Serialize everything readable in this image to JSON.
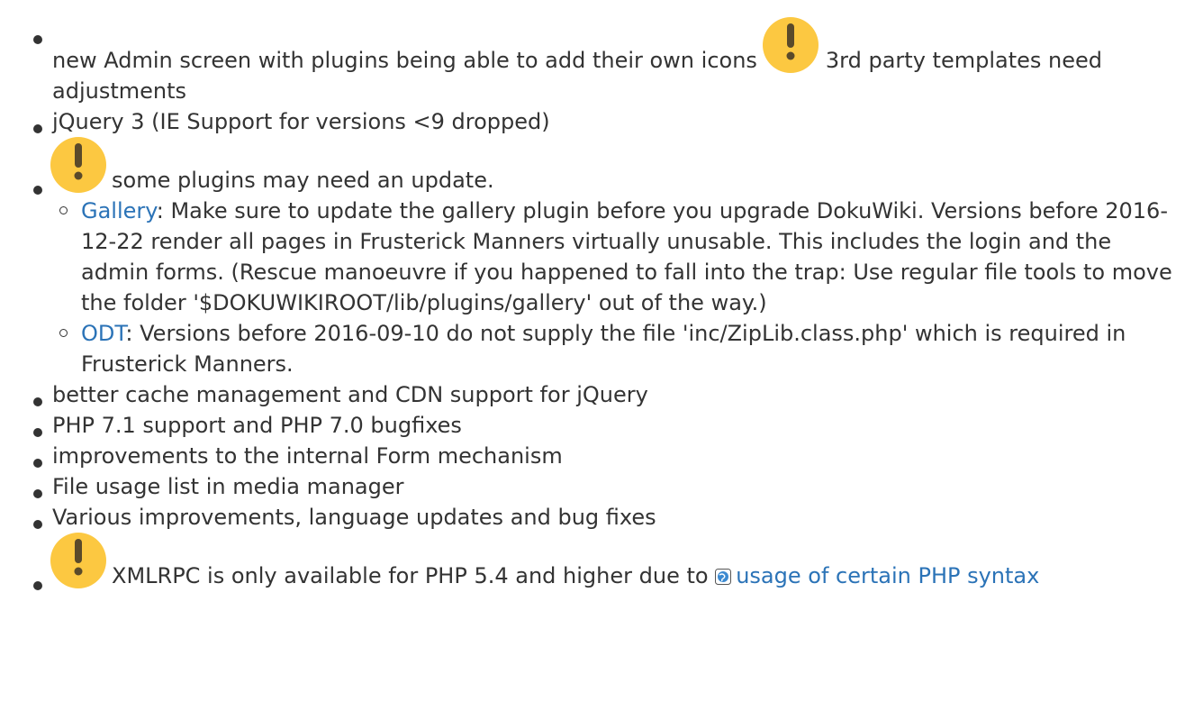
{
  "items": [
    {
      "before_icon": "new Admin screen with plugins being able to add their own icons",
      "after_icon": "3rd party templates need adjustments",
      "icon": "warning-icon"
    },
    {
      "text": "jQuery 3 (IE Support for versions <9 dropped)"
    },
    {
      "text": "some plugins may need an update.",
      "icon": "warning-icon",
      "subitems": [
        {
          "link": "Gallery",
          "text": ": Make sure to update the gallery plugin before you upgrade DokuWiki. Versions before 2016-12-22 render all pages in Frusterick Manners virtually unusable. This includes the login and the admin forms. (Rescue manoeuvre if you happened to fall into the trap: Use regular file tools to move the folder '$DOKUWIKIROOT/lib/plugins/gallery' out of the way.)"
        },
        {
          "link": "ODT",
          "text": ": Versions before 2016-09-10 do not supply the file 'inc/ZipLib.class.php' which is required in Frusterick Manners."
        }
      ]
    },
    {
      "text": "better cache management and CDN support for jQuery"
    },
    {
      "text": "PHP 7.1 support and PHP 7.0 bugfixes"
    },
    {
      "text": "improvements to the internal Form mechanism"
    },
    {
      "text": "File usage list in media manager"
    },
    {
      "text": "Various improvements, language updates and bug fixes"
    },
    {
      "text": "XMLRPC is only available for PHP 5.4 and higher due to",
      "icon": "warning-icon",
      "link": "usage of certain PHP syntax",
      "link_icon": "globe-icon"
    }
  ],
  "colors": {
    "text": "#333333",
    "link": "#2b73b7",
    "warning_fill": "#fcc841",
    "warning_mark": "#5a4a2a"
  }
}
